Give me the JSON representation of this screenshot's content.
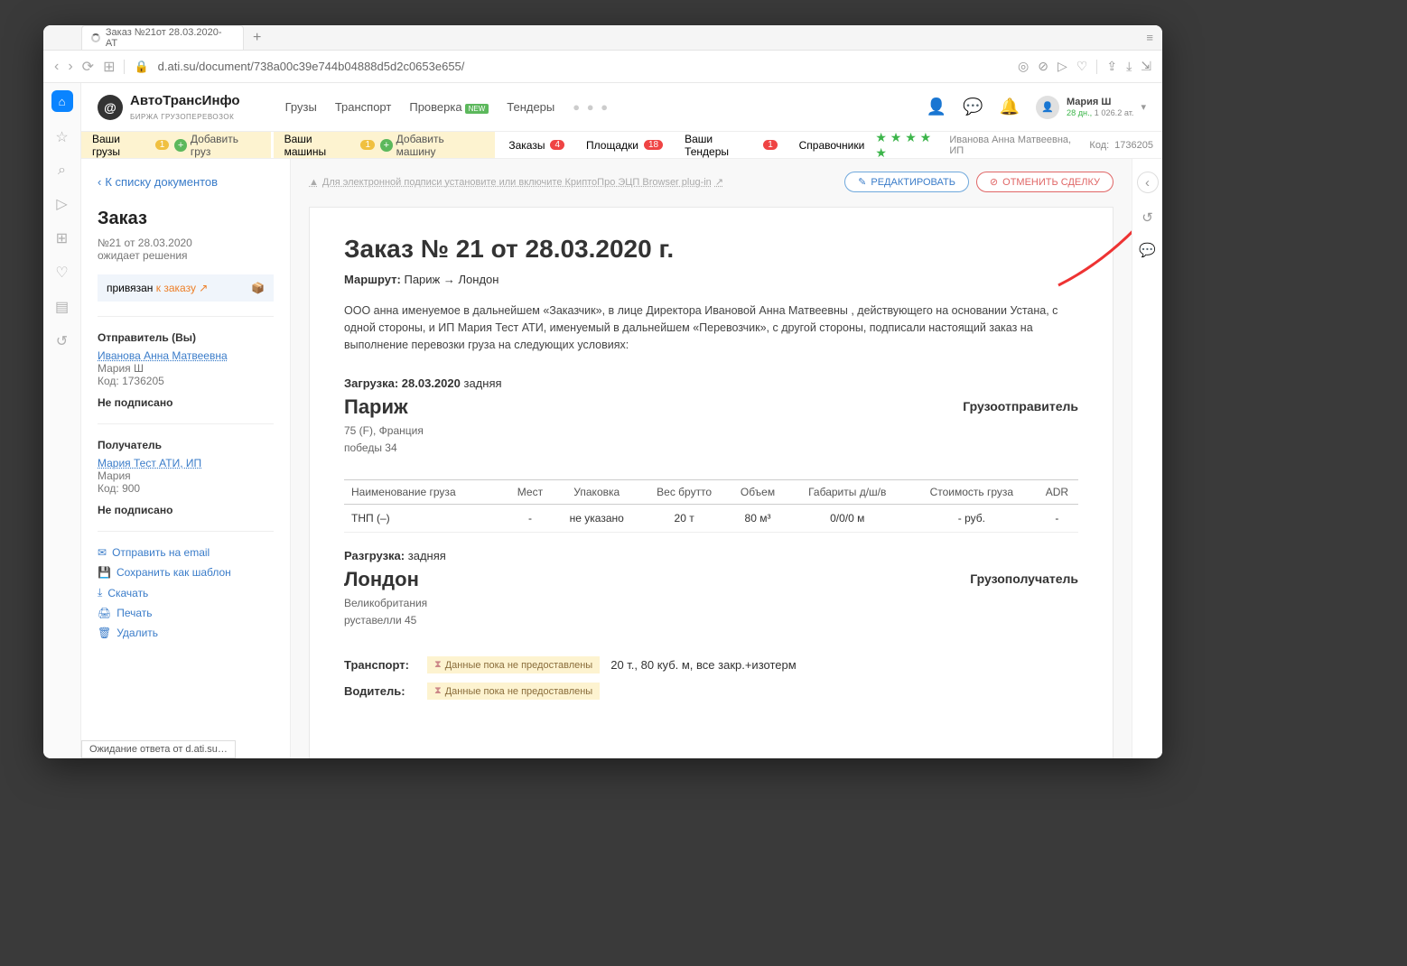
{
  "browser": {
    "tab_title": "Заказ №21от 28.03.2020- АТ",
    "url": "d.ati.su/document/738a00c39e744b04888d5d2c0653e655/",
    "status_text": "Ожидание ответа от d.ati.su…"
  },
  "header": {
    "logo_title": "АвтоТрансИнфо",
    "logo_sub": "БИРЖА ГРУЗОПЕРЕВОЗОК",
    "nav": {
      "cargo": "Грузы",
      "transport": "Транспорт",
      "check": "Проверка",
      "check_badge": "NEW",
      "tenders": "Тендеры"
    },
    "user_name": "Мария Ш",
    "user_meta_days": "28 дн.,",
    "user_meta_pts": "1 026.2 ат."
  },
  "subbar": {
    "your_cargo": "Ваши грузы",
    "your_cargo_cnt": "1",
    "add_cargo": "Добавить груз",
    "your_trucks": "Ваши машины",
    "your_trucks_cnt": "1",
    "add_truck": "Добавить машину",
    "orders": "Заказы",
    "orders_cnt": "4",
    "platforms": "Площадки",
    "platforms_cnt": "18",
    "your_tenders": "Ваши Тендеры",
    "your_tenders_cnt": "1",
    "directories": "Справочники",
    "company": "Иванова Анна Матвеевна, ИП",
    "code_lbl": "Код:",
    "code": "1736205"
  },
  "sidebar": {
    "back": "К списку документов",
    "title": "Заказ",
    "num_date": "№21 от 28.03.2020",
    "status": "ожидает решения",
    "linked_pre": "привязан",
    "linked": "к заказу",
    "sender_lbl": "Отправитель (Вы)",
    "sender_name": "Иванова Анна Матвеевна",
    "sender_person": "Мария Ш",
    "sender_code": "Код: 1736205",
    "sender_sign": "Не подписано",
    "receiver_lbl": "Получатель",
    "receiver_name": "Мария Тест АТИ, ИП",
    "receiver_person": "Мария",
    "receiver_code": "Код: 900",
    "receiver_sign": "Не подписано",
    "actions": {
      "email": "Отправить на email",
      "template": "Сохранить как шаблон",
      "download": "Скачать",
      "print": "Печать",
      "delete": "Удалить"
    }
  },
  "doc_header": {
    "warn": "Для электронной подписи установите или включите КриптоПро ЭЦП Browser plug-in",
    "edit_btn": "РЕДАКТИРОВАТЬ",
    "cancel_btn": "ОТМЕНИТЬ СДЕЛКУ"
  },
  "doc": {
    "title": "Заказ №  21 от 28.03.2020 г.",
    "route_lbl": "Маршрут:",
    "route_from": "Париж",
    "route_arrow": "→",
    "route_to": "Лондон",
    "intro": "ООО анна именуемое в дальнейшем «Заказчик», в лице Директора Ивановой Анна Матвеевны , действующего на основании Устана, с одной стороны, и ИП Мария Тест АТИ, именуемый в дальнейшем «Перевозчик», с другой стороны, подписали настоящий заказ на выполнение перевозки груза на следующих условиях:",
    "loading_lbl": "Загрузка:",
    "loading_date": "28.03.2020",
    "loading_type": "задняя",
    "city1": "Париж",
    "city1_sub1": "75 (F), Франция",
    "city1_sub2": "победы 34",
    "sender_party": "Грузоотправитель",
    "unloading_lbl": "Разгрузка:",
    "unloading_type": "задняя",
    "city2": "Лондон",
    "city2_sub1": "Великобритания",
    "city2_sub2": "руставелли 45",
    "receiver_party": "Грузополучатель",
    "cargo_table": {
      "h_name": "Наименование груза",
      "h_places": "Мест",
      "h_pack": "Упаковка",
      "h_weight": "Вес брутто",
      "h_vol": "Объем",
      "h_dim": "Габариты д/ш/в",
      "h_cost": "Стоимость груза",
      "h_adr": "ADR",
      "r_name": "ТНП (–)",
      "r_places": "-",
      "r_pack": "не указано",
      "r_weight": "20 т",
      "r_vol": "80 м³",
      "r_dim": "0/0/0 м",
      "r_cost": "- руб.",
      "r_adr": "-"
    },
    "transport_lbl": "Транспорт:",
    "transport_pending": "Данные пока не предоставлены",
    "transport_spec": "20 т., 80 куб. м, все закр.+изотерм",
    "driver_lbl": "Водитель:",
    "driver_pending": "Данные пока не предоставлены"
  }
}
